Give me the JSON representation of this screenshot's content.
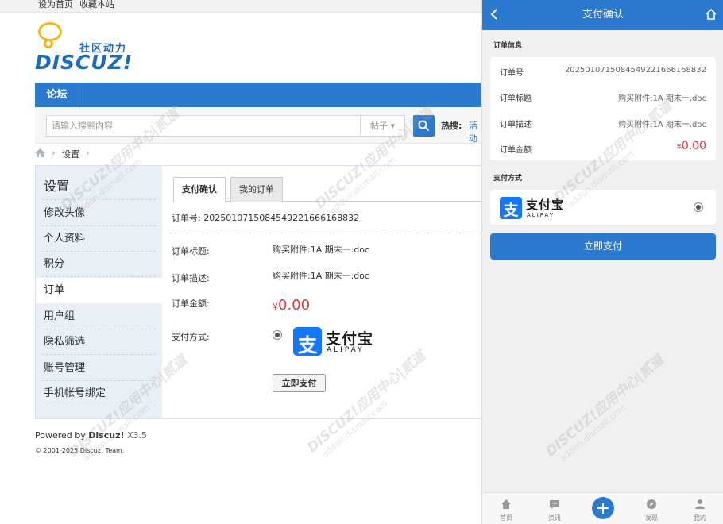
{
  "topbar": {
    "set_home": "设为首页",
    "bookmark": "收藏本站"
  },
  "logo": {
    "community": "社区动力",
    "brand": "DISCUZ!"
  },
  "nav": {
    "forum": "论坛"
  },
  "search": {
    "placeholder": "请输入搜索内容",
    "type": "帖子",
    "hot_label": "热搜:",
    "hot_link": "活动"
  },
  "breadcrumb": {
    "label": "设置"
  },
  "sidebar": {
    "title": "设置",
    "items": [
      {
        "label": "修改头像"
      },
      {
        "label": "个人资料"
      },
      {
        "label": "积分"
      },
      {
        "label": "订单"
      },
      {
        "label": "用户组"
      },
      {
        "label": "隐私筛选"
      },
      {
        "label": "账号管理"
      },
      {
        "label": "手机帐号绑定"
      }
    ]
  },
  "main": {
    "tabs": [
      {
        "label": "支付确认"
      },
      {
        "label": "我的订单"
      }
    ],
    "order_no": "订单号: 20250107150845492216661688 32",
    "order_no_clean": "订单号: 2025010715084549221666168832",
    "title_label": "订单标题:",
    "title_value": "购买附件:1A 期末一.doc",
    "desc_label": "订单描述:",
    "desc_value": "购买附件:1A 期末一.doc",
    "amount_label": "订单金额:",
    "amount_yen": "¥",
    "amount_value": "0.00",
    "pay_method_label": "支付方式:",
    "alipay_cn": "支付宝",
    "alipay_en": "ALIPAY",
    "alipay_mark": "支",
    "pay_button": "立即支付"
  },
  "footer": {
    "powered": "Powered by ",
    "brand": "Discuz!",
    "version": " X3.5",
    "copyright": "© 2001-2025 Discuz! Team."
  },
  "mobile": {
    "title": "支付确认",
    "order_info_title": "订单信息",
    "rows": [
      {
        "label": "订单号",
        "value": "2025010715084549221666168832"
      },
      {
        "label": "订单标题",
        "value": "购买附件:1A 期末一.doc"
      },
      {
        "label": "订单描述",
        "value": "购买附件:1A 期末一.doc"
      }
    ],
    "amount_label": "订单金额",
    "amount_yen": "¥",
    "amount_value": "0.00",
    "pay_method_title": "支付方式",
    "alipay_cn": "支付宝",
    "alipay_en": "ALIPAY",
    "alipay_mark": "支",
    "pay_button": "立即支付",
    "tabbar": [
      {
        "label": "首页",
        "icon": "home-icon"
      },
      {
        "label": "资讯",
        "icon": "chat-icon"
      },
      {
        "label": "",
        "icon": "plus-icon"
      },
      {
        "label": "发现",
        "icon": "compass-icon"
      },
      {
        "label": "我的",
        "icon": "user-icon"
      }
    ]
  },
  "watermark": {
    "text": "DISCUZ!应用中心|贰道",
    "sub": "addon.dismall.com"
  },
  "colors": {
    "primary": "#2b7acf",
    "accent_red": "#e8343b",
    "alipay_blue": "#1677ff",
    "sidebar_bg": "#e8eff5"
  }
}
